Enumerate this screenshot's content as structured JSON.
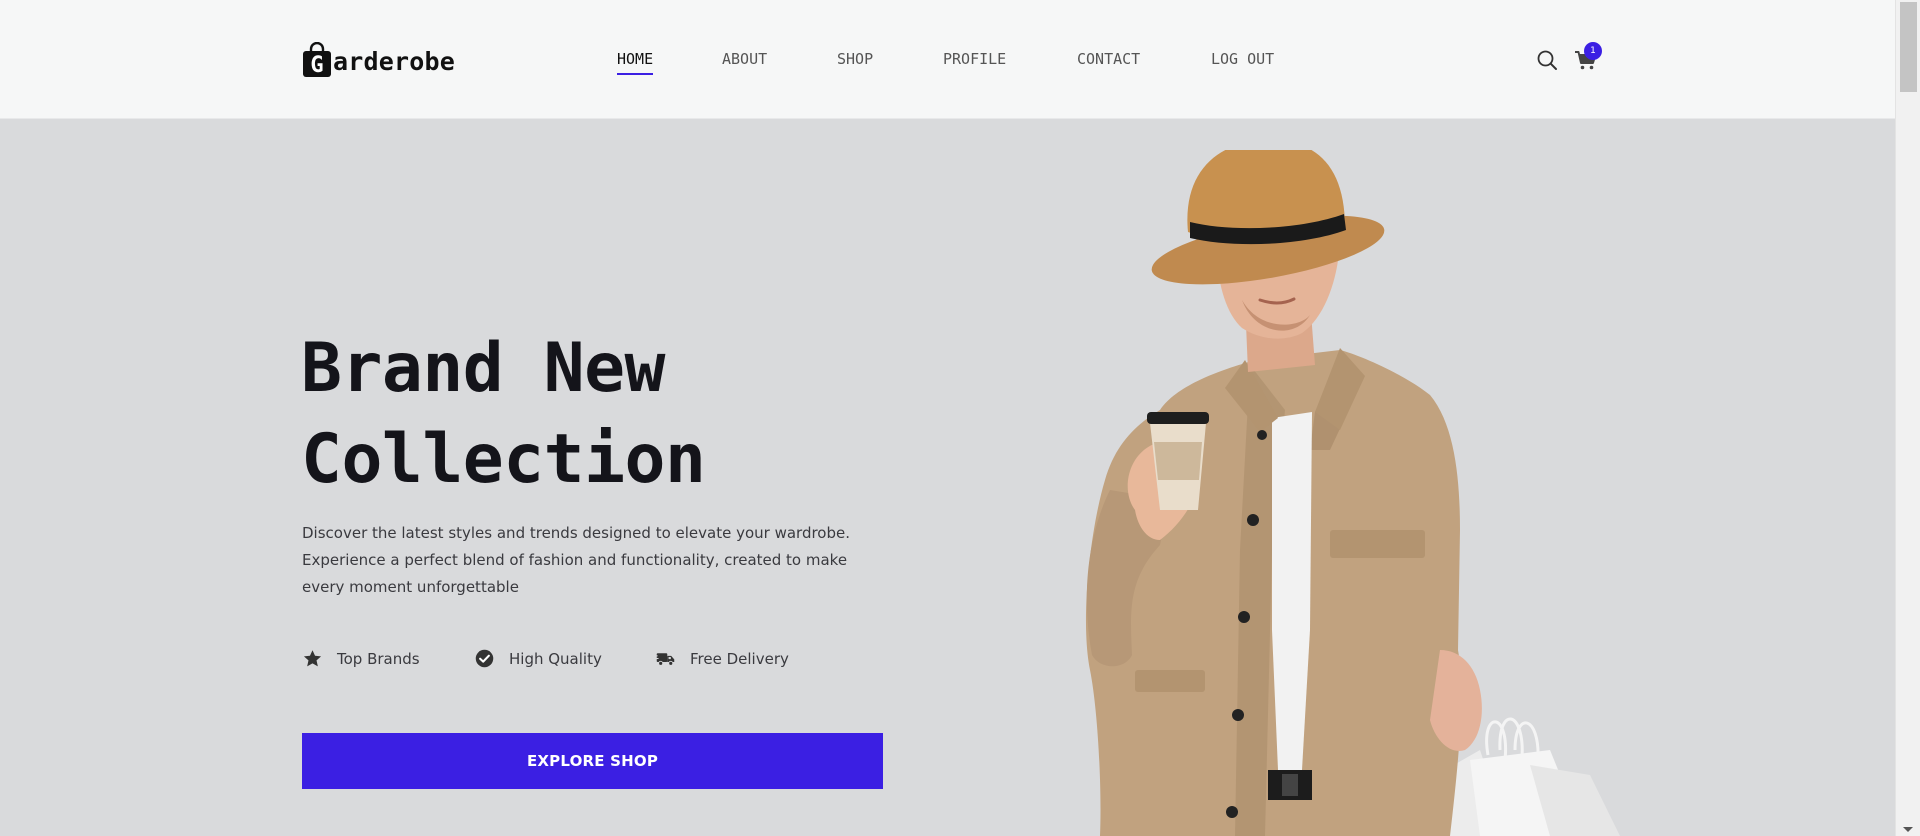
{
  "brand": {
    "logo_letter": "G",
    "logo_text": "arderobe"
  },
  "nav": {
    "items": [
      {
        "label": "HOME",
        "active": true
      },
      {
        "label": "ABOUT",
        "active": false
      },
      {
        "label": "SHOP",
        "active": false
      },
      {
        "label": "PROFILE",
        "active": false
      },
      {
        "label": "CONTACT",
        "active": false
      },
      {
        "label": "LOG OUT",
        "active": false
      }
    ]
  },
  "header": {
    "search_icon": "search-icon",
    "cart_icon": "cart-icon",
    "cart_count": "1"
  },
  "hero": {
    "title_line1": "Brand New",
    "title_line2": "Collection",
    "description": "Discover the latest styles and trends designed to elevate your wardrobe. Experience a perfect blend of fashion and functionality, created to make every moment unforgettable",
    "features": [
      {
        "label": "Top Brands",
        "icon": "star-icon"
      },
      {
        "label": "High Quality",
        "icon": "check-circle-icon"
      },
      {
        "label": "Free Delivery",
        "icon": "delivery-truck-icon"
      }
    ],
    "cta_label": "EXPLORE SHOP",
    "image": "man-with-hat-and-shopping-bags-image"
  },
  "colors": {
    "accent": "#3b1fe3",
    "header_bg": "#f6f7f7",
    "hero_bg": "#d9dadc",
    "text_dark": "#14141a"
  }
}
